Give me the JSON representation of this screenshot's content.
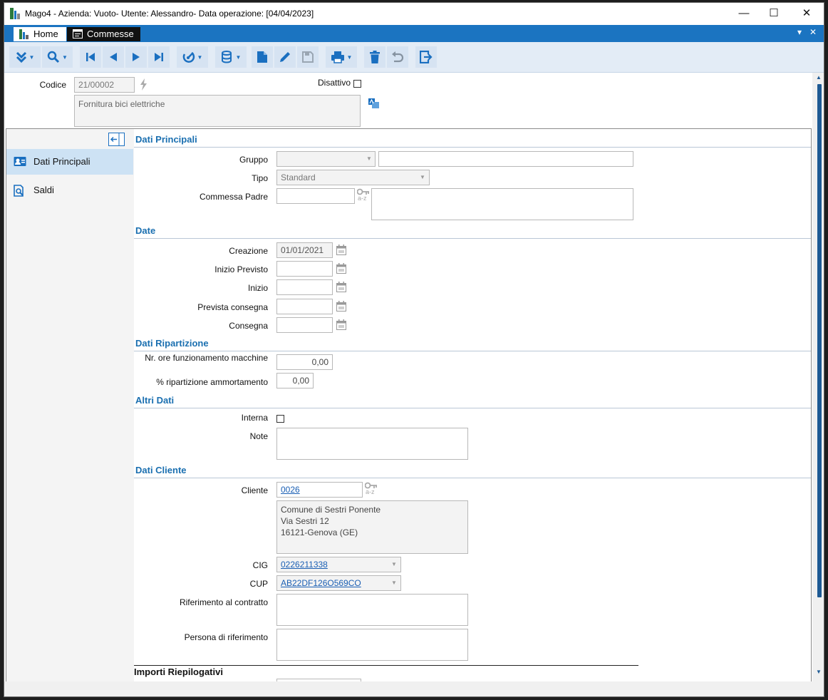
{
  "window": {
    "title": "Mago4 - Azienda: Vuoto- Utente: Alessandro- Data operazione: [04/04/2023]",
    "minimize": "—",
    "maximize": "☐",
    "close": "✕"
  },
  "tabs": [
    {
      "label": "Home",
      "icon": "home-icon"
    },
    {
      "label": "Commesse",
      "icon": "document-window-icon"
    }
  ],
  "tabstrip_controls": {
    "menu": "▾",
    "close": "✕"
  },
  "toolbar": {
    "icons": [
      "expand-icon",
      "search-icon",
      "first-record-icon",
      "previous-record-icon",
      "next-record-icon",
      "last-record-icon",
      "radar-icon",
      "database-icon",
      "new-document-icon",
      "edit-icon",
      "save-icon",
      "print-icon",
      "delete-icon",
      "undo-icon",
      "exit-icon"
    ],
    "accent": "#1a6fc0"
  },
  "header": {
    "codice_label": "Codice",
    "codice_value": "21/00002",
    "disattivo_label": "Disattivo",
    "description": "Fornitura bici elettriche"
  },
  "sidebar": {
    "items": [
      {
        "label": "Dati Principali",
        "icon": "id-card-icon",
        "selected": true
      },
      {
        "label": "Saldi",
        "icon": "report-search-icon",
        "selected": false
      }
    ]
  },
  "sections": {
    "dati_principali": "Dati Principali",
    "date": "Date",
    "dati_ripartizione": "Dati Ripartizione",
    "altri_dati": "Altri Dati",
    "dati_cliente": "Dati Cliente",
    "importi": "Importi Riepilogativi"
  },
  "fields": {
    "gruppo": {
      "label": "Gruppo",
      "value": "",
      "description": ""
    },
    "tipo": {
      "label": "Tipo",
      "value": "Standard"
    },
    "commessa_padre": {
      "label": "Commessa Padre",
      "value": "",
      "description": ""
    },
    "creazione": {
      "label": "Creazione",
      "value": "01/01/2021"
    },
    "inizio_previsto": {
      "label": "Inizio Previsto",
      "value": ""
    },
    "inizio": {
      "label": "Inizio",
      "value": ""
    },
    "prevista_consegna": {
      "label": "Prevista consegna",
      "value": ""
    },
    "consegna": {
      "label": "Consegna",
      "value": ""
    },
    "ore_macchine": {
      "label": "Nr. ore funzionamento macchine",
      "value": "0,00"
    },
    "ripartizione": {
      "label": "% ripartizione ammortamento",
      "value": "0,00"
    },
    "interna": {
      "label": "Interna",
      "checked": false
    },
    "note": {
      "label": "Note",
      "value": ""
    },
    "cliente": {
      "label": "Cliente",
      "value": "0026",
      "address": "Comune di Sestri Ponente\nVia Sestri 12\n16121-Genova (GE)"
    },
    "cig": {
      "label": "CIG",
      "value": "0226211338"
    },
    "cup": {
      "label": "CUP",
      "value": "AB22DF126O569CO"
    },
    "riferimento_contratto": {
      "label": "Riferimento al contratto",
      "value": ""
    },
    "persona_riferimento": {
      "label": "Persona di riferimento",
      "value": ""
    }
  },
  "az_icon_text": "a-z"
}
